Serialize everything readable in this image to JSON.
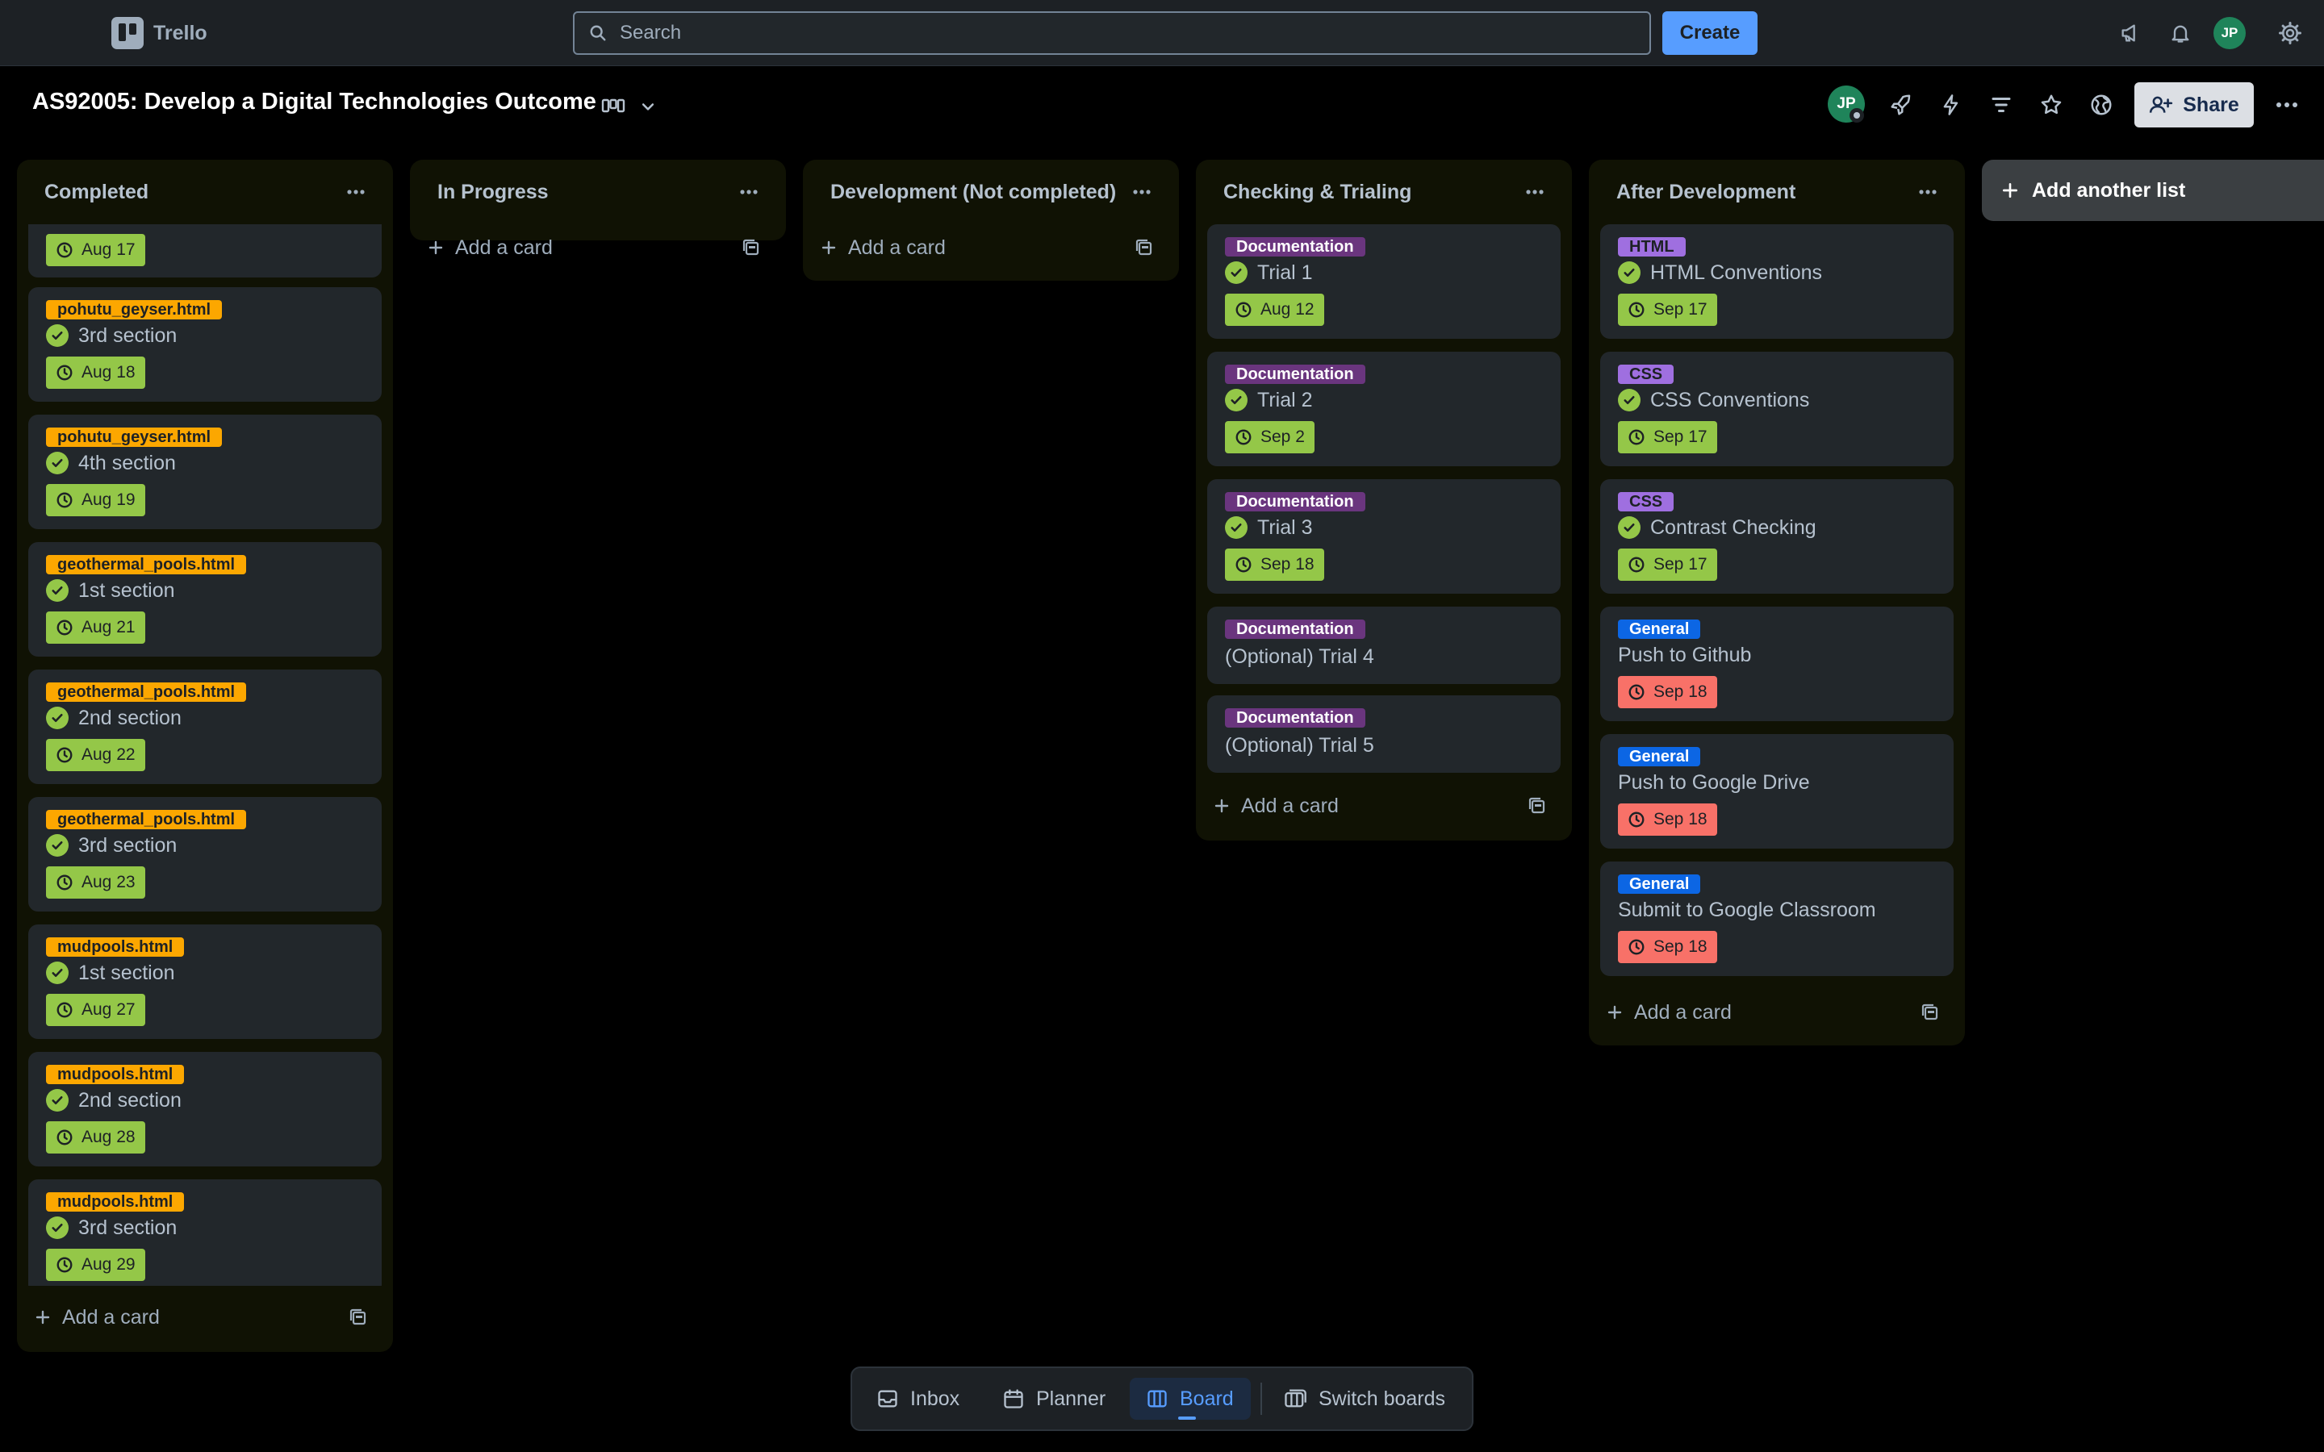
{
  "topbar": {
    "app_name": "Trello",
    "search_placeholder": "Search",
    "create_label": "Create",
    "user_initials": "JP"
  },
  "board": {
    "title": "AS92005: Develop a Digital Technologies Outcome",
    "share_label": "Share",
    "member_initials": "JP"
  },
  "lists": [
    {
      "title": "Completed",
      "add_card_label": "Add a card",
      "cards": [
        {
          "label": "",
          "title": "",
          "due": "Aug 17",
          "done": false
        },
        {
          "label": "pohutu_geyser.html",
          "title": "3rd section",
          "due": "Aug 18",
          "done": true
        },
        {
          "label": "pohutu_geyser.html",
          "title": "4th section",
          "due": "Aug 19",
          "done": true
        },
        {
          "label": "geothermal_pools.html",
          "title": "1st section",
          "due": "Aug 21",
          "done": true
        },
        {
          "label": "geothermal_pools.html",
          "title": "2nd section",
          "due": "Aug 22",
          "done": true
        },
        {
          "label": "geothermal_pools.html",
          "title": "3rd section",
          "due": "Aug 23",
          "done": true
        },
        {
          "label": "mudpools.html",
          "title": "1st section",
          "due": "Aug 27",
          "done": true
        },
        {
          "label": "mudpools.html",
          "title": "2nd section",
          "due": "Aug 28",
          "done": true
        },
        {
          "label": "mudpools.html",
          "title": "3rd section",
          "due": "Aug 29",
          "done": true
        }
      ]
    },
    {
      "title": "In Progress",
      "add_card_label": "Add a card",
      "cards": []
    },
    {
      "title": "Development (Not completed)",
      "add_card_label": "Add a card",
      "cards": []
    },
    {
      "title": "Checking & Trialing",
      "add_card_label": "Add a card",
      "cards": [
        {
          "label": "Documentation",
          "title": "Trial 1",
          "due": "Aug 12",
          "done": true
        },
        {
          "label": "Documentation",
          "title": "Trial 2",
          "due": "Sep 2",
          "done": true
        },
        {
          "label": "Documentation",
          "title": "Trial 3",
          "due": "Sep 18",
          "done": true
        },
        {
          "label": "Documentation",
          "title": "(Optional) Trial 4",
          "due": "",
          "done": false
        },
        {
          "label": "Documentation",
          "title": "(Optional) Trial 5",
          "due": "",
          "done": false
        }
      ]
    },
    {
      "title": "After Development",
      "add_card_label": "Add a card",
      "cards": [
        {
          "label": "HTML",
          "title": "HTML Conventions",
          "due": "Sep 17",
          "done": true
        },
        {
          "label": "CSS",
          "title": "CSS Conventions",
          "due": "Sep 17",
          "done": true
        },
        {
          "label": "CSS",
          "title": "Contrast Checking",
          "due": "Sep 17",
          "done": true
        },
        {
          "label": "General",
          "title": "Push to Github",
          "due": "Sep 18",
          "done": false,
          "overdue": true
        },
        {
          "label": "General",
          "title": "Push to Google Drive",
          "due": "Sep 18",
          "done": false,
          "overdue": true
        },
        {
          "label": "General",
          "title": "Submit to Google Classroom",
          "due": "Sep 18",
          "done": false,
          "overdue": true
        }
      ]
    }
  ],
  "add_list_label": "Add another list",
  "bottom_nav": {
    "inbox": "Inbox",
    "planner": "Planner",
    "board": "Board",
    "switch_boards": "Switch boards"
  },
  "colors": {
    "accent": "#579dff",
    "complete_green": "#94c748",
    "overdue_red": "#f87168",
    "label_orange": "#fca700",
    "label_purple": "#6a357e",
    "label_light_purple": "#9f6fe0",
    "label_blue": "#0c66e4"
  }
}
